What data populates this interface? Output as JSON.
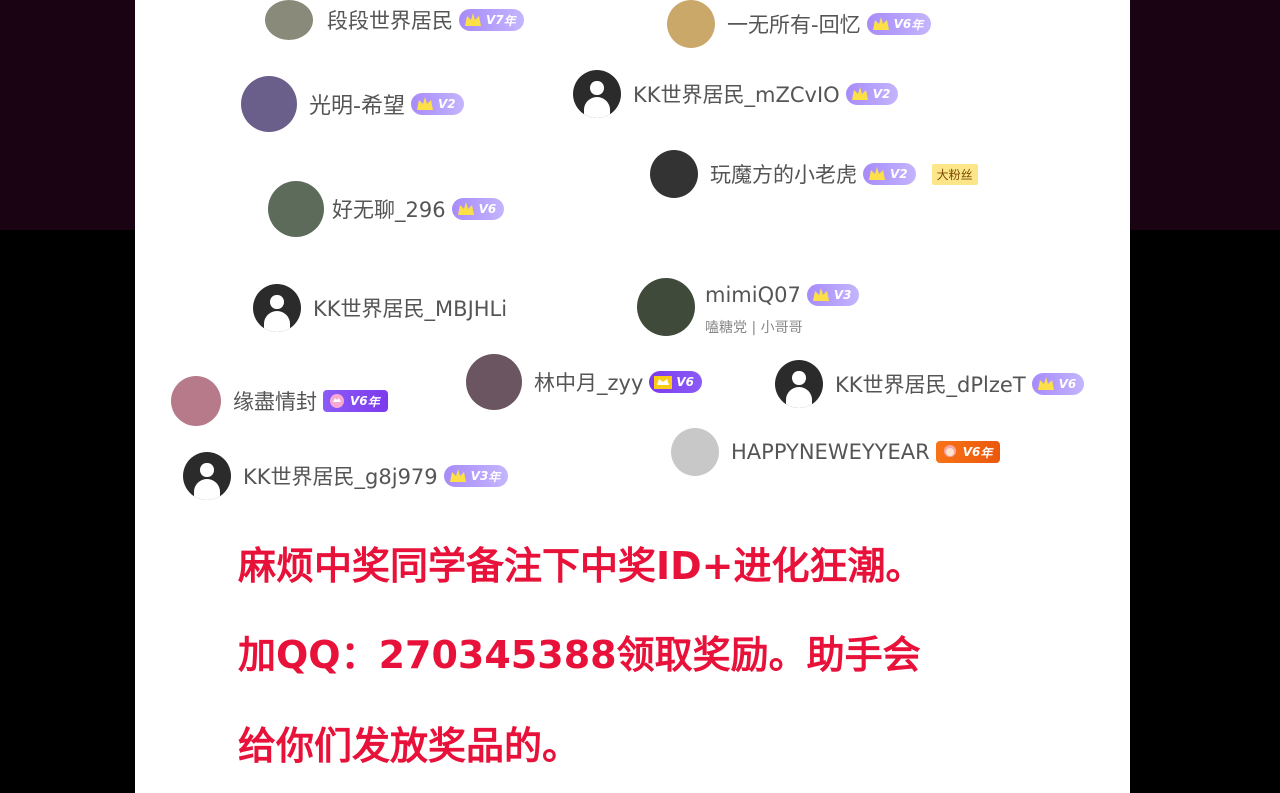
{
  "users": [
    {
      "id": "u1",
      "name": "段段世界居民",
      "level": "V7",
      "year": "年",
      "avatar_color": "#8a8a7a"
    },
    {
      "id": "u2",
      "name": "一无所有-回忆",
      "level": "V6",
      "year": "年",
      "avatar_color": "#c9a86a"
    },
    {
      "id": "u3",
      "name": "光明-希望",
      "level": "V2",
      "year": "",
      "avatar_color": "#6a5f8a"
    },
    {
      "id": "u4",
      "name": "KK世界居民_mZCvIO",
      "level": "V2",
      "year": "",
      "avatar_color": "#2b2b2b"
    },
    {
      "id": "u5",
      "name": "玩魔方的小老虎",
      "level": "V2",
      "year": "",
      "avatar_color": "#333333",
      "tag": "大粉丝"
    },
    {
      "id": "u6",
      "name": "好无聊_296",
      "level": "V6",
      "year": "",
      "avatar_color": "#5c6b5a"
    },
    {
      "id": "u7",
      "name": "KK世界居民_MBJHLi",
      "level": "",
      "year": "",
      "avatar_color": "#2b2b2b"
    },
    {
      "id": "u8",
      "name": "mimiQ07",
      "level": "V3",
      "year": "",
      "avatar_color": "#3f4a3a",
      "subtitle": "嗑糖党 | 小哥哥"
    },
    {
      "id": "u9",
      "name": "林中月_zyy",
      "level": "V6",
      "year": "",
      "avatar_color": "#6a5560"
    },
    {
      "id": "u10",
      "name": "KK世界居民_dPlzeT",
      "level": "V6",
      "year": "",
      "avatar_color": "#2b2b2b"
    },
    {
      "id": "u11",
      "name": "缘盡情封",
      "level": "V6",
      "year": "年",
      "avatar_color": "#b67a8a"
    },
    {
      "id": "u12",
      "name": "HAPPYNEWEYYEAR",
      "level": "V6",
      "year": "年",
      "avatar_color": "#c8c8c8"
    },
    {
      "id": "u13",
      "name": "KK世界居民_g8j979",
      "level": "V3",
      "year": "年",
      "avatar_color": "#2b2b2b"
    }
  ],
  "message": {
    "line1": "麻烦中奖同学备注下中奖ID+进化狂潮。",
    "line2": "加QQ：270345388领取奖励。助手会",
    "line3": "给你们发放奖品的。"
  },
  "colors": {
    "message": "#e8113a",
    "badge": "#a78bfa",
    "background": "#ffffff"
  }
}
